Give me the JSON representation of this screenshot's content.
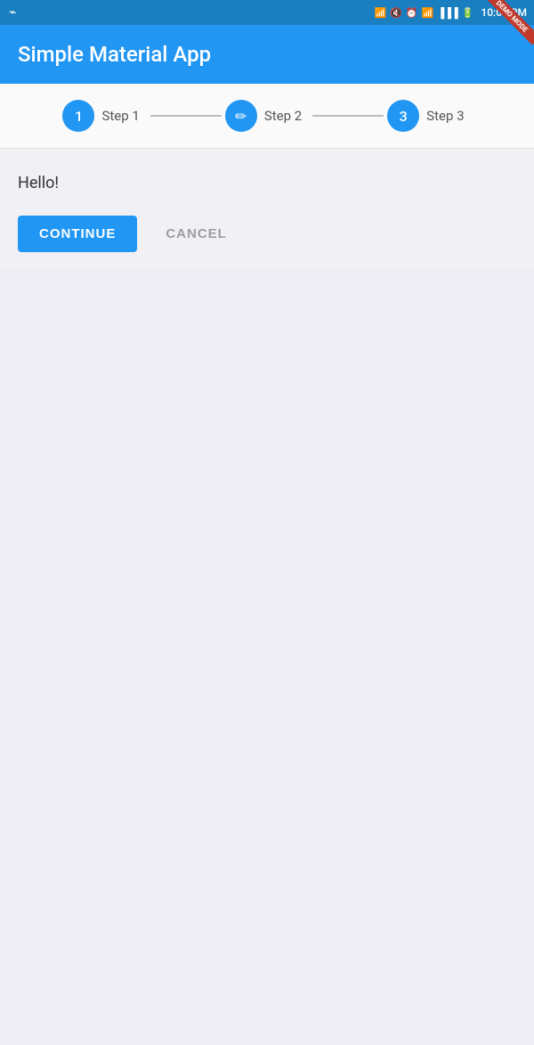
{
  "statusBar": {
    "time": "10:01 PM",
    "icons": [
      "bluetooth",
      "mute",
      "alarm",
      "wifi",
      "signal1",
      "signal2",
      "battery"
    ]
  },
  "demoRibbon": {
    "label": "DEMO MODE"
  },
  "appBar": {
    "title": "Simple Material App"
  },
  "stepper": {
    "steps": [
      {
        "id": 1,
        "label": "Step 1",
        "state": "number",
        "value": "1"
      },
      {
        "id": 2,
        "label": "Step 2",
        "state": "edit",
        "value": "✎"
      },
      {
        "id": 3,
        "label": "Step 3",
        "state": "number",
        "value": "3"
      }
    ]
  },
  "content": {
    "greeting": "Hello!",
    "continueLabel": "CONTINUE",
    "cancelLabel": "CANCEL"
  }
}
